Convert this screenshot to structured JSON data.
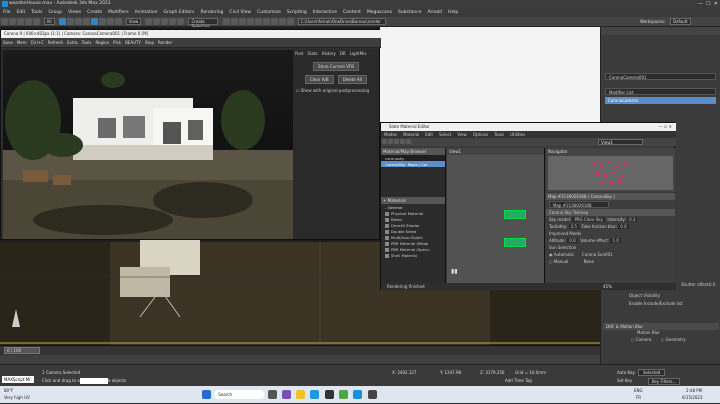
{
  "app": {
    "title": "woodenHouse.max - Autodesk 3ds Max 2023"
  },
  "menu": [
    "File",
    "Edit",
    "Tools",
    "Group",
    "Views",
    "Create",
    "Modifiers",
    "Animation",
    "Graph Editors",
    "Rendering",
    "Civil View",
    "Customize",
    "Scripting",
    "Interactive",
    "Content",
    "Megascans",
    "Substance",
    "Arnold",
    "Help"
  ],
  "toolbar": {
    "selection_filter": "All",
    "view_dd": "View",
    "create_selection_set": "Create Selection Se",
    "path": "C:\\Users\\ferrak\\OneDrive\\Bureau\\render",
    "workspaces_label": "Workspaces:",
    "workspace_value": "Default"
  },
  "vfb": {
    "title": "Corona 9 | 640×403px (1:1) | Camera: CoronaCamera001 | Frame 0 [M]",
    "tools": [
      "Save",
      "Mem",
      "Ctrl+C",
      "Refresh",
      "Extra",
      "Tools",
      "Region",
      "Pick",
      "BEAUTY",
      "Stop",
      "Render"
    ],
    "side_tabs": [
      "Post",
      "Stats",
      "History",
      "DR",
      "LightMix"
    ],
    "store_btn": "Store Current VFB",
    "clear_btn": "Clear A/B",
    "delete_btn": "Delete All",
    "checkbox_label": "Show with original postprocessing"
  },
  "sme": {
    "title": "Slate Material Editor",
    "menu": [
      "Modes",
      "Material",
      "Edit",
      "Select",
      "View",
      "Options",
      "Tools",
      "Utilities"
    ],
    "browser_head": "Material/Map Browser",
    "search_label": "coronasky",
    "search_result": "CoronaSky",
    "search_result_tag": "Maps | Cor",
    "materials_head": "+ Materials",
    "general_head": "- General",
    "materials": [
      "Physical Material",
      "Blend",
      "DirectX Shader",
      "Double Sided",
      "Multi/Sub-Object",
      "PBR Material (Metal",
      "PBR Material (Specu",
      "Shell Material"
    ],
    "view_label": "View1",
    "view_dd": "View1",
    "navigator_label": "Navigator",
    "map_title": "Map #2136026168 ( CoronaSky )",
    "map_field": "Map #2136026168",
    "rollout": "Corona Sky Texmap",
    "sky_model_label": "Sky model:",
    "sky_model_value": "PRG Clear Sky",
    "intensity_label": "Intensity:",
    "intensity_value": "0.3",
    "turbidity_label": "Turbidity:",
    "turbidity_value": "2.5",
    "fake_horizon_label": "Fake horizon blur:",
    "fake_horizon_value": "0.0",
    "improved_model": "Improved Model",
    "altitude_label": "Altitude:",
    "altitude_value": "0.0",
    "volume_effect_label": "Volume effect:",
    "volume_effect_value": "1.0",
    "sun_selection": "Sun Selection",
    "automatic_label": "Automatic",
    "sun_name": "Corona Sun001",
    "manual_label": "Manual",
    "none_label": "None",
    "status": "Rendering finished",
    "zoom": "45%"
  },
  "right_panel": {
    "object_name": "CoronaCamera001",
    "modifier_list": "Modifier List",
    "stack_item": "CoronaCamera",
    "shutter_label": "Shutter offset:",
    "shutter_value": "0.0",
    "object_visibility": "Object Visibility",
    "enable_include": "Enable Include/Exclude list",
    "dof_head": "DOF & Motion Blur",
    "motion_blur": "Motion Blur",
    "camera_label": "Camera",
    "geometry_label": "Geometry"
  },
  "timeline": {
    "frame": "0 / 100"
  },
  "status": {
    "maxscript": "MAXScript Mi:",
    "selected": "1 Camera Selected",
    "prompt": "Click and drag to select and move objects",
    "x_label": "X:",
    "x_value": "2402.127",
    "y_label": "Y:",
    "y_value": "1247.98",
    "z_label": "Z:",
    "z_value": "3179.256",
    "grid": "Grid = 10.0mm",
    "add_time_tag": "Add Time Tag",
    "auto_key": "Auto Key",
    "selected_dd": "Selected",
    "set_key": "Set Key",
    "key_filters": "Key Filters...",
    "search_placeholder": "Search"
  },
  "taskbar": {
    "temp": "80°F",
    "weather": "Very high UV",
    "search": "Search",
    "lang": "ENG",
    "region": "FR",
    "time": "2:48 PM",
    "date": "6/15/2023"
  }
}
